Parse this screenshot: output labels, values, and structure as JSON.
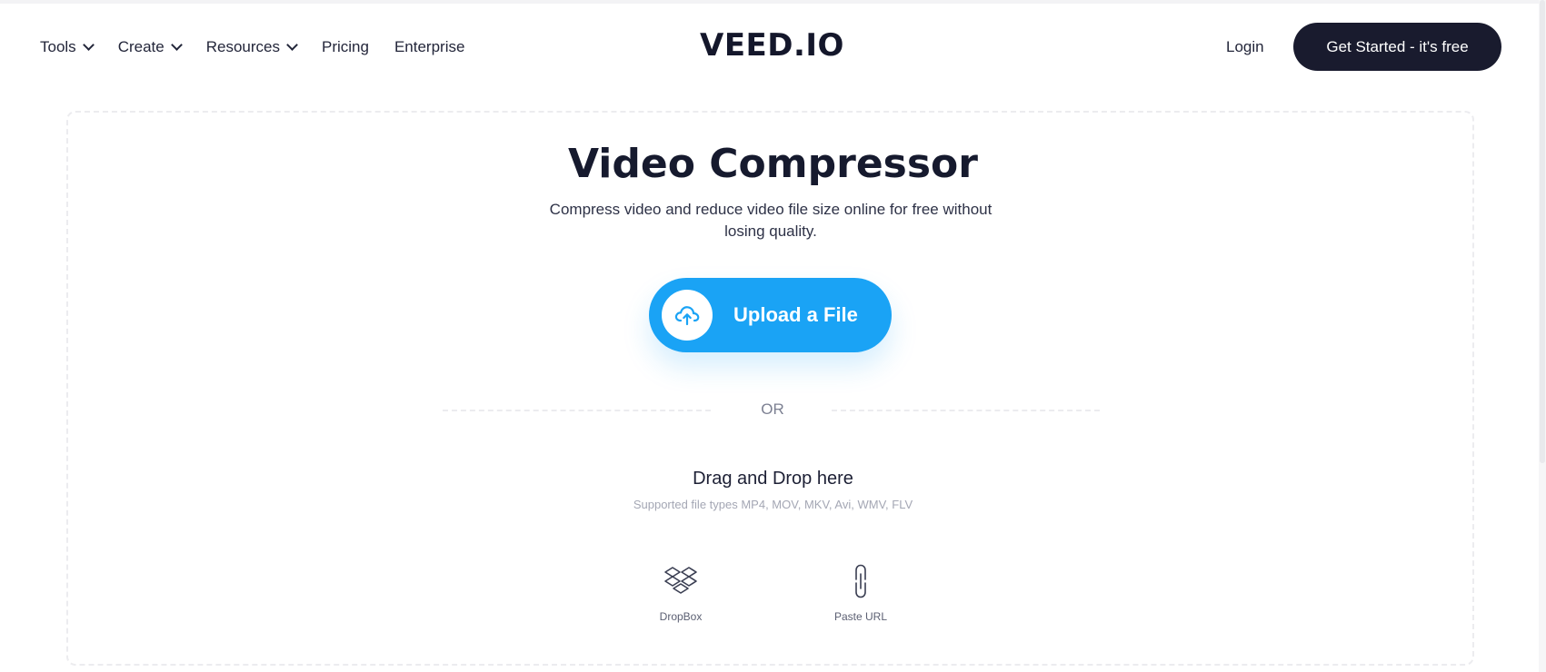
{
  "header": {
    "nav": [
      {
        "label": "Tools",
        "dropdown": true
      },
      {
        "label": "Create",
        "dropdown": true
      },
      {
        "label": "Resources",
        "dropdown": true
      },
      {
        "label": "Pricing",
        "dropdown": false
      },
      {
        "label": "Enterprise",
        "dropdown": false
      }
    ],
    "logo": "VEED.IO",
    "login_label": "Login",
    "cta_label": "Get Started - it's free"
  },
  "main": {
    "title": "Video Compressor",
    "subtitle": "Compress video and reduce video file size online for free without losing quality.",
    "upload_label": "Upload a File",
    "upload_icon": "cloud-upload-icon",
    "or_label": "OR",
    "drag_label": "Drag and Drop here",
    "supported_label": "Supported file types MP4, MOV, MKV, Avi, WMV, FLV",
    "sources": [
      {
        "label": "DropBox",
        "icon": "dropbox-icon"
      },
      {
        "label": "Paste URL",
        "icon": "link-icon"
      }
    ]
  },
  "colors": {
    "accent": "#1aa3f5",
    "dark_button": "#191b2e",
    "text": "#1a1d33",
    "muted": "#a4a7b4"
  }
}
